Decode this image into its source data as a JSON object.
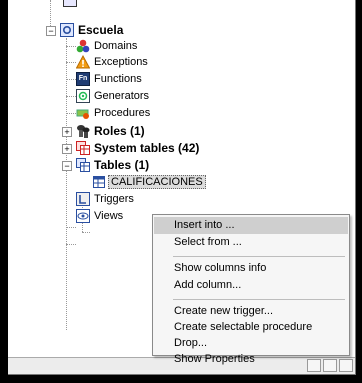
{
  "tree": {
    "root": "Escuela",
    "items": {
      "domains": "Domains",
      "exceptions": "Exceptions",
      "functions": "Functions",
      "generators": "Generators",
      "procedures": "Procedures",
      "roles": "Roles (1)",
      "system_tables": "System tables (42)",
      "tables": "Tables (1)",
      "calificaciones": "CALIFICACIONES",
      "triggers": "Triggers",
      "views": "Views"
    },
    "expander_minus": "−",
    "expander_plus": "+",
    "functions_icon_text": "Fn"
  },
  "context_menu": {
    "items": [
      "Insert into ...",
      "Select from ...",
      "Show columns info",
      "Add column...",
      "Create new trigger...",
      "Create selectable procedure",
      "Drop...",
      "Show Properties"
    ],
    "highlighted": "Insert into ..."
  },
  "colors": {
    "background": "#000000",
    "panel": "#ffffff",
    "menu": "#f6f6f6",
    "highlight": "#cfcfcf"
  }
}
